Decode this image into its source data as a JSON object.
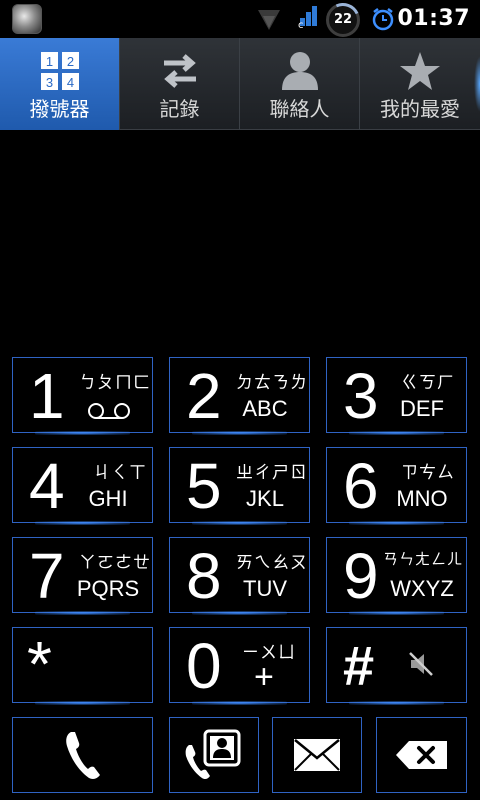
{
  "status_bar": {
    "time": "01:37",
    "battery_level": "22",
    "carrier_badge": "c",
    "icons": [
      "app-orb-icon",
      "signal-icon",
      "data-icon",
      "battery-circle-icon",
      "alarm-icon"
    ]
  },
  "tabs": [
    {
      "label": "撥號器",
      "icon": "dialpad-grid-icon",
      "active": true
    },
    {
      "label": "記錄",
      "icon": "swap-arrows-icon",
      "active": false
    },
    {
      "label": "聯絡人",
      "icon": "person-icon",
      "active": false
    },
    {
      "label": "我的最愛",
      "icon": "star-icon",
      "active": false
    }
  ],
  "dialpad_icon_digits": [
    "1",
    "2",
    "3",
    "4"
  ],
  "keys": [
    {
      "digit": "1",
      "bopomofo": "ㄅㄆㄇㄈ",
      "letters": ""
    },
    {
      "digit": "2",
      "bopomofo": "ㄉㄊㄋㄌ",
      "letters": "ABC"
    },
    {
      "digit": "3",
      "bopomofo": "ㄍㄎㄏ",
      "letters": "DEF"
    },
    {
      "digit": "4",
      "bopomofo": "ㄐㄑㄒ",
      "letters": "GHI"
    },
    {
      "digit": "5",
      "bopomofo": "ㄓㄔㄕㄖ",
      "letters": "JKL"
    },
    {
      "digit": "6",
      "bopomofo": "ㄗㄘㄙ",
      "letters": "MNO"
    },
    {
      "digit": "7",
      "bopomofo": "ㄚㄛㄜㄝ",
      "letters": "PQRS"
    },
    {
      "digit": "8",
      "bopomofo": "ㄞㄟㄠㄡ",
      "letters": "TUV"
    },
    {
      "digit": "9",
      "bopomofo": "ㄢㄣㄤㄥㄦ",
      "letters": "WXYZ"
    },
    {
      "digit": "*",
      "bopomofo": "",
      "letters": ""
    },
    {
      "digit": "0",
      "bopomofo": "ㄧㄨㄩ",
      "letters": "+"
    },
    {
      "digit": "#",
      "bopomofo": "",
      "letters": ""
    }
  ],
  "actions": [
    {
      "icon": "phone-call-icon"
    },
    {
      "icon": "phone-contacts-icon"
    },
    {
      "icon": "envelope-icon"
    },
    {
      "icon": "backspace-icon"
    }
  ],
  "colors": {
    "accent_blue": "#2f63c4",
    "active_tab": "#2a6ac6",
    "tab_bar": "#262a2f"
  }
}
